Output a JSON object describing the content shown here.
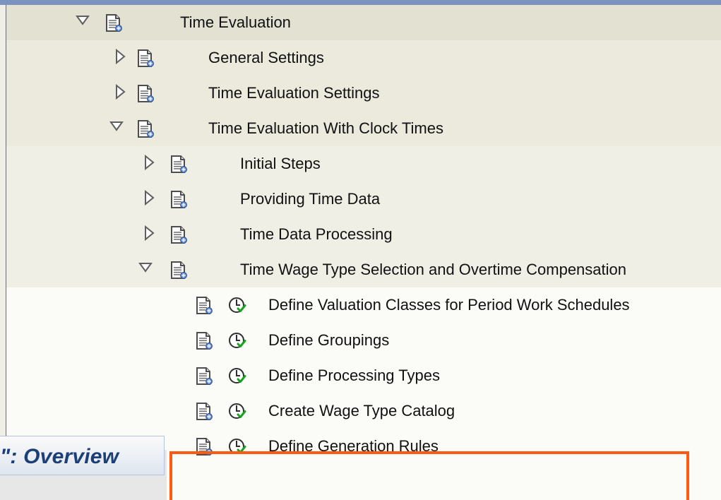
{
  "tree": {
    "rows": [
      {
        "label": "Time Evaluation",
        "level": 0,
        "expanded": true,
        "type": "folder"
      },
      {
        "label": "General Settings",
        "level": 1,
        "expanded": false,
        "type": "folder"
      },
      {
        "label": "Time Evaluation Settings",
        "level": 1,
        "expanded": false,
        "type": "folder"
      },
      {
        "label": "Time Evaluation With Clock Times",
        "level": 1,
        "expanded": true,
        "type": "folder"
      },
      {
        "label": "Initial Steps",
        "level": 2,
        "expanded": false,
        "type": "folder"
      },
      {
        "label": "Providing Time Data",
        "level": 2,
        "expanded": false,
        "type": "folder"
      },
      {
        "label": "Time Data Processing",
        "level": 2,
        "expanded": false,
        "type": "folder"
      },
      {
        "label": "Time Wage Type Selection and Overtime Compensation",
        "level": 2,
        "expanded": true,
        "type": "folder"
      },
      {
        "label": "Define Valuation Classes for Period Work Schedules",
        "level": 3,
        "type": "activity"
      },
      {
        "label": "Define Groupings",
        "level": 3,
        "type": "activity"
      },
      {
        "label": "Define Processing Types",
        "level": 3,
        "type": "activity"
      },
      {
        "label": "Create Wage Type Catalog",
        "level": 3,
        "type": "activity"
      },
      {
        "label": "Define Generation Rules",
        "level": 3,
        "type": "activity",
        "highlighted": true
      }
    ]
  },
  "overlay": {
    "overview_text": "\": Overview"
  },
  "icons": {
    "document": "document-icon",
    "execute": "execute-icon",
    "expanded_toggle": "triangle-down-icon",
    "collapsed_toggle": "triangle-right-icon"
  },
  "colors": {
    "highlight": "#ff5a12",
    "overview_text": "#1d3f78",
    "top_strip": "#7d93bf"
  }
}
